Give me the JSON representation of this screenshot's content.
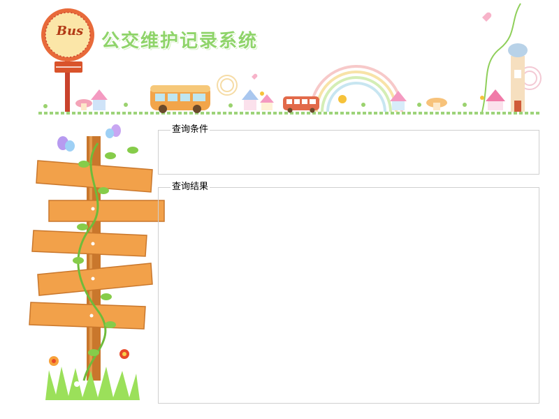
{
  "header": {
    "title": "公交维护记录系统",
    "bus_sign": "Bus"
  },
  "query_panel": {
    "legend": "查询条件"
  },
  "result_panel": {
    "legend": "查询结果"
  },
  "colors": {
    "title_green": "#8fd46a",
    "panel_border": "#cfcfcf",
    "sign_orange": "#f4a23c",
    "bus_sign_red": "#d9532b"
  },
  "icons": [
    "bus-stop-sign-icon",
    "bus-icon",
    "house-icon",
    "rainbow-icon",
    "butterfly-icon",
    "flower-icon",
    "wooden-signpost-icon"
  ]
}
